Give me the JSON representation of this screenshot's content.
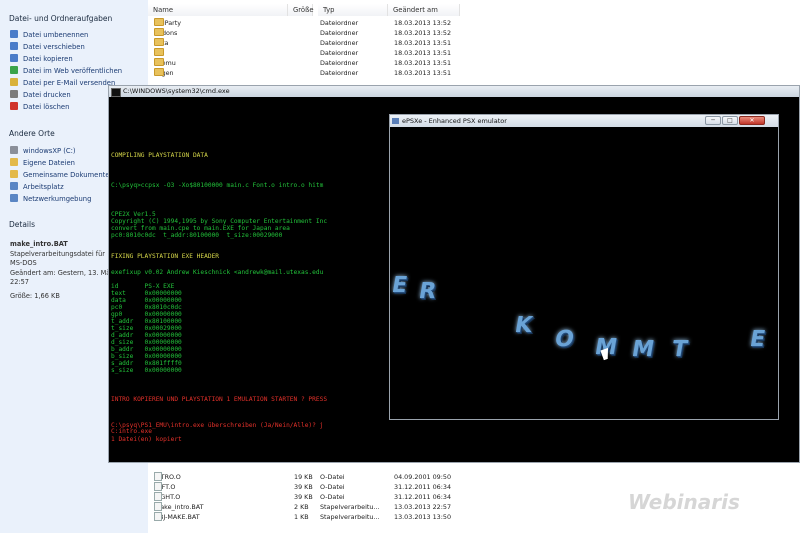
{
  "taskpane": {
    "file_tasks_title": "Datei- und Ordneraufgaben",
    "file_tasks": [
      {
        "label": "Datei umbenennen",
        "icon": "rename-icon",
        "color": "#4a7cc9"
      },
      {
        "label": "Datei verschieben",
        "icon": "move-icon",
        "color": "#4a7cc9"
      },
      {
        "label": "Datei kopieren",
        "icon": "copy-icon",
        "color": "#4a7cc9"
      },
      {
        "label": "Datei im Web veröffentlichen",
        "icon": "web-publish-icon",
        "color": "#3aa34a"
      },
      {
        "label": "Datei per E-Mail versenden",
        "icon": "email-icon",
        "color": "#d9b23b"
      },
      {
        "label": "Datei drucken",
        "icon": "printer-icon",
        "color": "#7b7b7b"
      },
      {
        "label": "Datei löschen",
        "icon": "delete-icon",
        "color": "#d0332a"
      }
    ],
    "other_places_title": "Andere Orte",
    "other_places": [
      {
        "label": "windowsXP (C:)",
        "icon": "drive-icon",
        "color": "#8a8f99"
      },
      {
        "label": "Eigene Dateien",
        "icon": "my-documents-icon",
        "color": "#e3b94a"
      },
      {
        "label": "Gemeinsame Dokumente",
        "icon": "shared-folder-icon",
        "color": "#e3b94a"
      },
      {
        "label": "Arbeitsplatz",
        "icon": "computer-icon",
        "color": "#5a86c4"
      },
      {
        "label": "Netzwerkumgebung",
        "icon": "network-icon",
        "color": "#5a86c4"
      }
    ],
    "details_title": "Details",
    "details": {
      "name": "make_intro.BAT",
      "type_line1": "Stapelverarbeitungsdatei für",
      "type_line2": "MS-DOS",
      "modified_line1": "Geändert am: Gestern, 13. März",
      "modified_line2": "22:57",
      "size": "Größe: 1,66 KB"
    }
  },
  "explorer": {
    "columns": {
      "name": "Name",
      "size": "Größe",
      "type": "Typ",
      "modified": "Geändert am"
    },
    "top_rows": [
      {
        "name": "3rdParty",
        "size": "",
        "type": "Dateiordner",
        "modified": "18.03.2013 13:52"
      },
      {
        "name": "addons",
        "size": "",
        "type": "Dateiordner",
        "modified": "18.03.2013 13:52"
      },
      {
        "name": "beta",
        "size": "",
        "type": "Dateiordner",
        "modified": "18.03.2013 13:51"
      },
      {
        "name": "bin",
        "size": "",
        "type": "Dateiordner",
        "modified": "18.03.2013 13:51"
      },
      {
        "name": "cdemu",
        "size": "",
        "type": "Dateiordner",
        "modified": "18.03.2013 13:51"
      },
      {
        "name": "cdgen",
        "size": "",
        "type": "Dateiordner",
        "modified": "18.03.2013 13:51"
      }
    ],
    "bottom_rows": [
      {
        "name": "INTRO.O",
        "size": "19 KB",
        "type": "O-Datei",
        "modified": "04.09.2001 09:50"
      },
      {
        "name": "LEFT.O",
        "size": "39 KB",
        "type": "O-Datei",
        "modified": "31.12.2011 06:34"
      },
      {
        "name": "RIGHT.O",
        "size": "39 KB",
        "type": "O-Datei",
        "modified": "31.12.2011 06:34"
      },
      {
        "name": "make_intro.BAT",
        "size": "2 KB",
        "type": "Stapelverarbeitu...",
        "modified": "13.03.2013 22:57"
      },
      {
        "name": "OBJ-MAKE.BAT",
        "size": "1 KB",
        "type": "Stapelverarbeitu...",
        "modified": "13.03.2013 13:50"
      }
    ]
  },
  "cmd": {
    "title": "C:\\WINDOWS\\system32\\cmd.exe",
    "lines": [
      {
        "text": "COMPILING PLAYSTATION DATA",
        "cls": "y"
      },
      {
        "text": "C:\\psyq>ccpsx -O3 -Xo$80100000 main.c Font.o intro.o hitm",
        "cls": "g"
      },
      {
        "text": "CPE2X Ver1.5",
        "cls": "g"
      },
      {
        "text": "Copyright (C) 1994,1995 by Sony Computer Entertainment Inc",
        "cls": "g"
      },
      {
        "text": "convert from main.cpe to main.EXE for Japan area",
        "cls": "g"
      },
      {
        "text": "pc0:8010c0dc  t_addr:80100000  t_size:00029000",
        "cls": "g"
      },
      {
        "text": "FIXING PLAYSTATION EXE HEADER",
        "cls": "y"
      },
      {
        "text": "exefixup v0.02 Andrew Kieschnick <andrewk@mail.utexas.edu",
        "cls": "g"
      },
      {
        "text": "id       PS-X EXE",
        "cls": "g"
      },
      {
        "text": "text     0x00000000",
        "cls": "g"
      },
      {
        "text": "data     0x00000000",
        "cls": "g"
      },
      {
        "text": "pc0      0x8010c0dc",
        "cls": "g"
      },
      {
        "text": "gp0      0x00000000",
        "cls": "g"
      },
      {
        "text": "t_addr   0x80100000",
        "cls": "g"
      },
      {
        "text": "t_size   0x00029000",
        "cls": "g"
      },
      {
        "text": "d_addr   0x00000000",
        "cls": "g"
      },
      {
        "text": "d_size   0x00000000",
        "cls": "g"
      },
      {
        "text": "b_addr   0x00000000",
        "cls": "g"
      },
      {
        "text": "b_size   0x00000000",
        "cls": "g"
      },
      {
        "text": "s_addr   0x801ffff0",
        "cls": "g"
      },
      {
        "text": "s_size   0x00000000",
        "cls": "g"
      },
      {
        "text": "INTRO KOPIEREN UND PLAYSTATION 1 EMULATION STARTEN ? PRESS",
        "cls": "r"
      },
      {
        "text": "C:\\psyq\\PS1_EMU\\intro.exe überschreiben (Ja/Nein/Alle)? j",
        "cls": "r"
      },
      {
        "text": "C:intro.exe",
        "cls": "r"
      },
      {
        "text": "1 Datei(en) kopiert",
        "cls": "r"
      }
    ]
  },
  "epsxe": {
    "title": "ePSXe - Enhanced PSX emulator",
    "min_glyph": "─",
    "max_glyph": "□",
    "close_glyph": "✕",
    "scroller_letters": [
      "E",
      "R",
      "K",
      "O",
      "M",
      "M",
      "T",
      "E"
    ]
  },
  "watermark": "Webinaris"
}
